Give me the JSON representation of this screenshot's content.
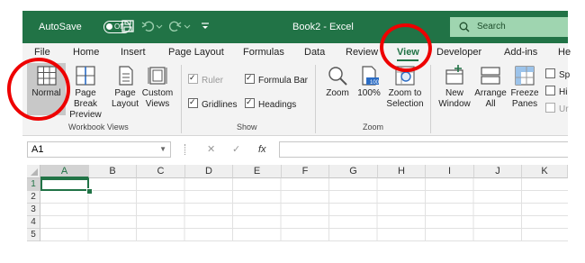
{
  "titlebar": {
    "autosave_label": "AutoSave",
    "autosave_state": "Off",
    "title": "Book2 - Excel",
    "search_placeholder": "Search",
    "color": "#217346"
  },
  "tabs": [
    "File",
    "Home",
    "Insert",
    "Page Layout",
    "Formulas",
    "Data",
    "Review",
    "View",
    "Developer",
    "Add-ins",
    "He"
  ],
  "active_tab": "View",
  "ribbon": {
    "workbook_views": {
      "label": "Workbook Views",
      "buttons": [
        {
          "line1": "Normal",
          "line2": "",
          "icon": "normal-view-icon"
        },
        {
          "line1": "Page Break",
          "line2": "Preview",
          "icon": "page-break-preview-icon"
        },
        {
          "line1": "Page",
          "line2": "Layout",
          "icon": "page-layout-icon"
        },
        {
          "line1": "Custom",
          "line2": "Views",
          "icon": "custom-views-icon"
        }
      ]
    },
    "show": {
      "label": "Show",
      "checks": [
        {
          "label": "Ruler",
          "checked": true,
          "disabled": true
        },
        {
          "label": "Formula Bar",
          "checked": true,
          "disabled": false
        },
        {
          "label": "Gridlines",
          "checked": true,
          "disabled": false
        },
        {
          "label": "Headings",
          "checked": true,
          "disabled": false
        }
      ]
    },
    "zoom": {
      "label": "Zoom",
      "buttons": [
        {
          "line1": "Zoom",
          "line2": "",
          "icon": "magnifier-icon"
        },
        {
          "line1": "100%",
          "line2": "",
          "icon": "zoom-100-icon"
        },
        {
          "line1": "Zoom to",
          "line2": "Selection",
          "icon": "zoom-selection-icon"
        }
      ],
      "badge": "100"
    },
    "window": {
      "buttons": [
        {
          "line1": "New",
          "line2": "Window",
          "icon": "new-window-icon"
        },
        {
          "line1": "Arrange",
          "line2": "All",
          "icon": "arrange-all-icon"
        },
        {
          "line1": "Freeze",
          "line2": "Panes",
          "icon": "freeze-panes-icon"
        }
      ],
      "small": [
        "Sp",
        "Hi",
        "Ur"
      ]
    }
  },
  "formula_bar": {
    "name_box": "A1",
    "cancel": "✕",
    "enter": "✓",
    "fx": "fx"
  },
  "grid": {
    "columns": [
      "A",
      "B",
      "C",
      "D",
      "E",
      "F",
      "G",
      "H",
      "I",
      "J",
      "K"
    ],
    "rows": [
      "1",
      "2",
      "3",
      "4",
      "5"
    ],
    "selected_cell": "A1"
  },
  "annotations": {
    "color": "#e00000"
  }
}
